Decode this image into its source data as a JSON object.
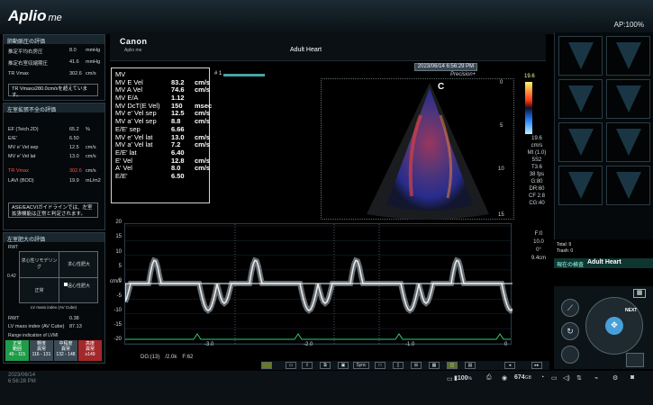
{
  "app": {
    "logo": "Aplio",
    "logo_suffix": "me",
    "ap": "AP:100%"
  },
  "header": {
    "brand": "Canon",
    "model": "Aplio me",
    "preset": "Adult Heart",
    "timestamp": "2023/06/14 6:56:29 PM",
    "precision": "Precision+",
    "image_label": "C",
    "probe_marker": "# 1"
  },
  "left_panel": {
    "sec1": {
      "title": "肺動脈圧の評価",
      "rows": [
        [
          "推定平均右房圧",
          "8.0",
          "mmHg"
        ],
        [
          "推定右室収縮期圧",
          "41.6",
          "mmHg"
        ],
        [
          "TR Vmax",
          "302.6",
          "cm/s"
        ]
      ],
      "note": "TR Vmax≥280.0cm/sを超えています。"
    },
    "sec2": {
      "title": "左室拡張不全の評価",
      "rows": [
        [
          "EF (Teich.2D)",
          "65.2",
          "%"
        ],
        [
          "E/E'",
          "6.50",
          ""
        ],
        [
          "MV e' Vel sep",
          "12.5",
          "cm/s"
        ],
        [
          "MV e' Vel lat",
          "13.0",
          "cm/s"
        ],
        [
          "TR Vmax",
          "302.6",
          "cm/s"
        ],
        [
          "LAVI (BOD)",
          "19.9",
          "mL/m2"
        ]
      ],
      "note": "ASE/EACVIガイドラインでは、左室拡張機能は正常と判定されます。"
    },
    "sec3": {
      "title": "左室肥大の評価",
      "rwt": "RWT",
      "y_axis_value": "0.42",
      "quadrants": [
        "求心性リモデリング",
        "求心性肥大",
        "正常",
        "遠心性肥大"
      ],
      "x_axis_label": "LV mass index (AV Cube)",
      "stats": [
        [
          "RWT",
          "0.38"
        ],
        [
          "LV mass index (AV Cube)",
          "87.13"
        ]
      ],
      "range_label": "Range indication of LVMI",
      "legend": [
        {
          "label": "正常",
          "sub": "範囲",
          "range": "49 - 115",
          "color": "#1f9c4a"
        },
        {
          "label": "軽度",
          "sub": "異常",
          "range": "116 - 131",
          "color": "#3b4a55"
        },
        {
          "label": "中程度",
          "sub": "異常",
          "range": "132 - 148",
          "color": "#3b4a55"
        },
        {
          "label": "高度",
          "sub": "異常",
          "range": "≥149",
          "color": "#a3282a"
        }
      ]
    }
  },
  "measurements": [
    {
      "label": "MV",
      "value": "",
      "unit": ""
    },
    {
      "label": "MV E Vel",
      "value": "83.2",
      "unit": "cm/s"
    },
    {
      "label": "MV A Vel",
      "value": "74.6",
      "unit": "cm/s"
    },
    {
      "label": "MV E/A",
      "value": "1.12",
      "unit": ""
    },
    {
      "label": "MV DcT(E Vel)",
      "value": "150",
      "unit": "msec"
    },
    {
      "label": "MV e' Vel sep",
      "value": "12.5",
      "unit": "cm/s"
    },
    {
      "label": "MV a' Vel sep",
      "value": "8.8",
      "unit": "cm/s"
    },
    {
      "label": "E/E' sep",
      "value": "6.66",
      "unit": ""
    },
    {
      "label": "MV e' Vel lat",
      "value": "13.0",
      "unit": "cm/s"
    },
    {
      "label": "MV a' Vel lat",
      "value": "7.2",
      "unit": "cm/s"
    },
    {
      "label": "E/E' lat",
      "value": "6.40",
      "unit": ""
    },
    {
      "label": "E' Vel",
      "value": "12.8",
      "unit": "cm/s"
    },
    {
      "label": "A' Vel",
      "value": "8.0",
      "unit": "cm/s"
    },
    {
      "label": "E/E'",
      "value": "6.50",
      "unit": ""
    }
  ],
  "image_params": [
    "19.6",
    "cm/s",
    "19.6",
    "cm/s",
    "MI (1.0)",
    "5S2",
    "T3.6",
    "38 fps",
    "G:80",
    "DR:60",
    "CF 2.8",
    "CG:40"
  ],
  "depth_scale": [
    "0",
    "5",
    "10",
    "15"
  ],
  "doppler": {
    "params_right": [
      "F:0",
      "10.0",
      "0°",
      "9.4cm"
    ],
    "unit": "cm/s",
    "y_ticks": [
      "20",
      "15",
      "10",
      "5",
      "0",
      "-5",
      "-10",
      "-15",
      "-20"
    ],
    "x_ticks": [
      "-3.0",
      "-2.0",
      "-1.0",
      "0"
    ],
    "footer_left": "DG:(13)",
    "footer_mid": "/2.0k",
    "footer_right": "F:62"
  },
  "right_panel": {
    "total": "Total: 9",
    "trash": "Trash: 0",
    "exam_label": "現在の検査",
    "exam_value": "Adult Heart",
    "next": "NEXT"
  },
  "toolbar": {
    "sync": "Sync"
  },
  "status": {
    "date": "2023/06/14",
    "time": "6:56:28 PM",
    "battery": "100",
    "storage": "674",
    "storage_unit": "GB"
  }
}
